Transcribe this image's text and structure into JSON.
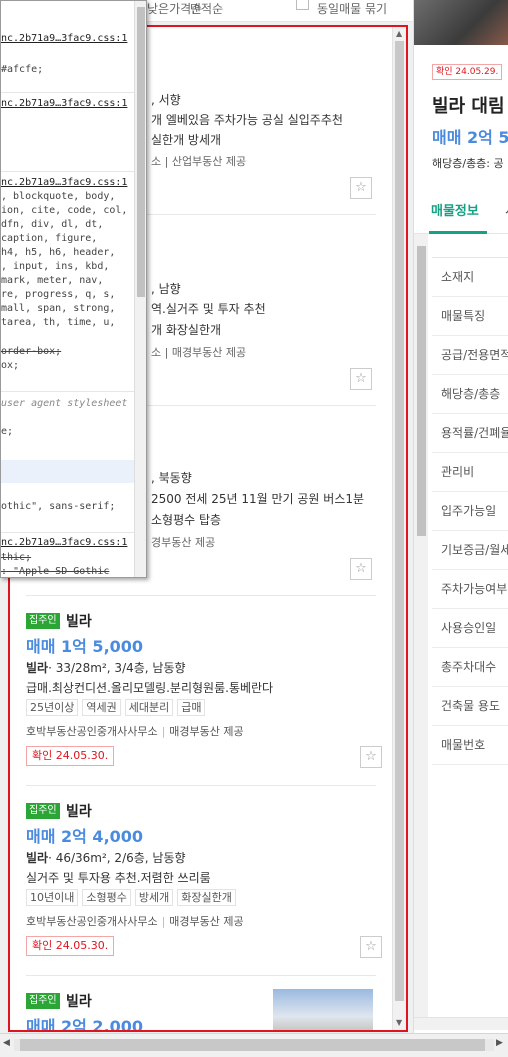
{
  "topbar": {
    "sort_a": "낮은가격순",
    "sort_b": "면적순",
    "toggle_label": "동일매물 묶기"
  },
  "partial_cards": [
    {
      "row1": ", 서향",
      "row2": "개 엘베있음 주차가능 공실 실입주추천",
      "row3": "실한개 방세개",
      "row4": "소 | 산업부동산 제공"
    },
    {
      "row1": ", 남향",
      "row2": "역.실거주 및 투자 추천",
      "row3": "개 화장실한개",
      "row4": "소 | 매경부동산 제공"
    },
    {
      "row1": ", 북동향",
      "row2": "2500 전세 25년 11월 만기 공원 버스1분",
      "row3": "소형평수 탑층",
      "row4": "경부동산 제공"
    }
  ],
  "cards": [
    {
      "badge": "집주인",
      "type": "빌라",
      "price": "매매 1억 5,000",
      "spec_type": "빌라",
      "spec_detail": "· 33/28m², 3/4층, 남동향",
      "desc": "급매.최상컨디션.올리모델링.분리형원룸.통베란다",
      "tags": [
        "25년이상",
        "역세권",
        "세대분리",
        "급매"
      ],
      "agent": "호박부동산공인중개사사무소",
      "provider": "매경부동산 제공",
      "verified": "확인 24.05.30."
    },
    {
      "badge": "집주인",
      "type": "빌라",
      "price": "매매 2억 4,000",
      "spec_type": "빌라",
      "spec_detail": "· 46/36m², 2/6층, 남동향",
      "desc": "실거주 및 투자용 추천.저렴한 쓰리룸",
      "tags": [
        "10년이내",
        "소형평수",
        "방세개",
        "화장실한개"
      ],
      "agent": "호박부동산공인중개사사무소",
      "provider": "매경부동산 제공",
      "verified": "확인 24.05.30."
    },
    {
      "badge": "집주인",
      "type": "빌라",
      "price": "매매 2억 2,000"
    }
  ],
  "devtools": {
    "lines": [
      {
        "text": "nc.2b71a9…3fac9.css:1",
        "kind": "src"
      },
      {
        "text": "#afcfe;",
        "kind": "code"
      },
      {
        "text": "nc.2b71a9…3fac9.css:1",
        "kind": "src"
      },
      {
        "text": "nc.2b71a9…3fac9.css:1",
        "kind": "src"
      },
      {
        "text": ", blockquote, body,",
        "kind": "code"
      },
      {
        "text": "ion, cite, code, col,",
        "kind": "code"
      },
      {
        "text": "dfn, div, dl, dt,",
        "kind": "code"
      },
      {
        "text": "caption, figure,",
        "kind": "code"
      },
      {
        "text": "h4, h5, h6, header,",
        "kind": "code"
      },
      {
        "text": ", input, ins, kbd,",
        "kind": "code"
      },
      {
        "text": "mark, meter, nav,",
        "kind": "code"
      },
      {
        "text": "re, progress, q, s,",
        "kind": "code"
      },
      {
        "text": "mall, span, strong,",
        "kind": "code"
      },
      {
        "text": "tarea, th, time, u,",
        "kind": "code"
      },
      {
        "text": "order-box;",
        "kind": "strike"
      },
      {
        "text": "ox;",
        "kind": "code"
      },
      {
        "text": "user agent stylesheet",
        "kind": "ua"
      },
      {
        "text": "e;",
        "kind": "code"
      },
      {
        "text": "othic\", sans-serif;",
        "kind": "code"
      },
      {
        "text": "nc.2b71a9…3fac9.css:1",
        "kind": "src"
      },
      {
        "text": "thic;",
        "kind": "strike"
      },
      {
        "text": ": \"Apple SD Gothic",
        "kind": "strike"
      }
    ]
  },
  "detail": {
    "badge": "확인 24.05.29.",
    "title": "빌라 대림",
    "price": "매매 2억 5",
    "floor": "해당층/총층: 공",
    "tab_active": "매물정보",
    "tab_next": "시",
    "rows": [
      "소재지",
      "매물특징",
      "공급/전용면적",
      "해당층/총층",
      "용적률/건폐율",
      "관리비",
      "입주가능일",
      "기보증금/월세",
      "주차가능여부",
      "사용승인일",
      "총주차대수",
      "건축물 용도",
      "매물번호"
    ]
  },
  "colors": {
    "selection_border": "#e0141e",
    "price_blue": "#4a8bdf",
    "owner_badge": "#2ca537",
    "tab_green": "#16a085"
  }
}
